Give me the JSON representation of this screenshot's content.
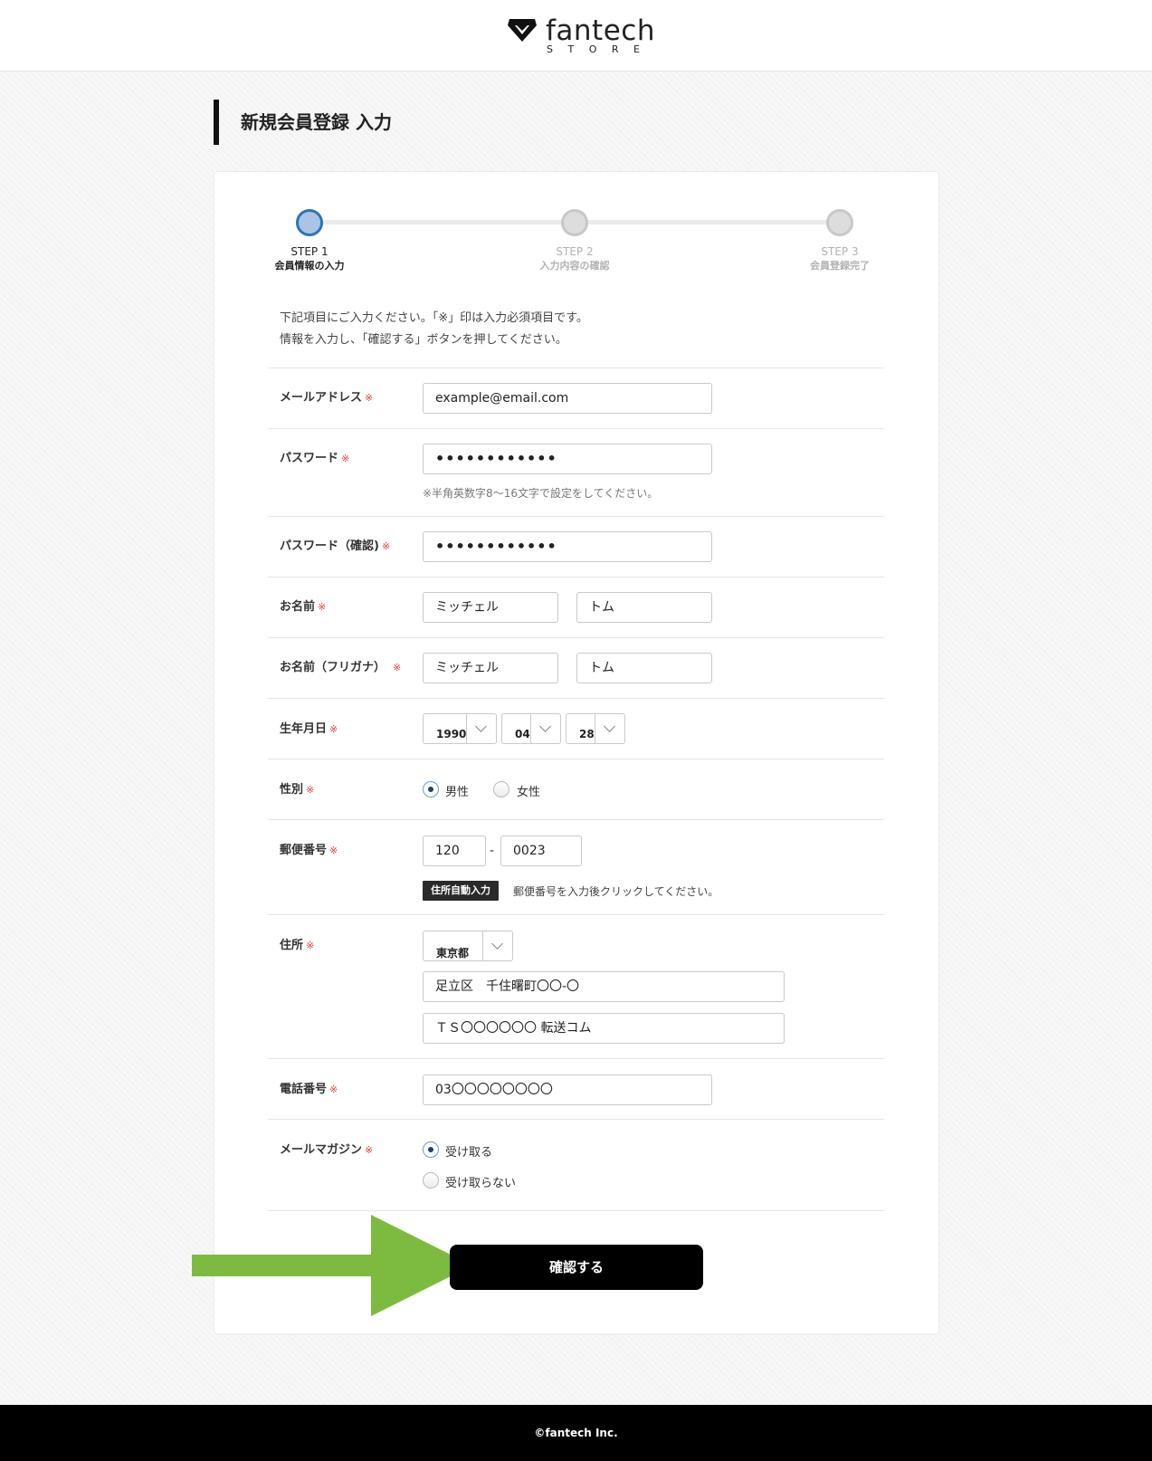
{
  "brand": {
    "name": "fantech",
    "sub": "STORE"
  },
  "page_title": "新規会員登録 入力",
  "steps": [
    {
      "step": "STEP 1",
      "label": "会員情報の入力",
      "active": true
    },
    {
      "step": "STEP 2",
      "label": "入力内容の確認",
      "active": false
    },
    {
      "step": "STEP 3",
      "label": "会員登録完了",
      "active": false
    }
  ],
  "intro": [
    "下記項目にご入力ください。「※」印は入力必須項目です。",
    "情報を入力し、「確認する」ボタンを押してください。"
  ],
  "required_mark": "※",
  "fields": {
    "email": {
      "label": "メールアドレス",
      "value": "example@email.com"
    },
    "password": {
      "label": "パスワード",
      "value": "••••••••••••",
      "hint": "※半角英数字8〜16文字で設定をしてください。"
    },
    "password_confirm": {
      "label": "パスワード（確認)",
      "value": "••••••••••••"
    },
    "name": {
      "label": "お名前",
      "last": "ミッチェル",
      "first": "トム"
    },
    "name_kana": {
      "label": "お名前（フリガナ）",
      "last": "ミッチェル",
      "first": "トム"
    },
    "birthday": {
      "label": "生年月日",
      "year": "1990",
      "month": "04",
      "day": "28"
    },
    "gender": {
      "label": "性別",
      "options": [
        "男性",
        "女性"
      ],
      "selected": "男性"
    },
    "postal": {
      "label": "郵便番号",
      "first": "120",
      "sep": "-",
      "second": "0023",
      "auto_button": "住所自動入力",
      "auto_hint": "郵便番号を入力後クリックしてください。"
    },
    "address": {
      "label": "住所",
      "prefecture": "東京都",
      "line1": "足立区　千住曙町〇〇-〇",
      "line2": "ＴＳ〇〇〇〇〇〇 転送コム"
    },
    "phone": {
      "label": "電話番号",
      "value": "03〇〇〇〇〇〇〇〇"
    },
    "newsletter": {
      "label": "メールマガジン",
      "options": [
        "受け取る",
        "受け取らない"
      ],
      "selected": "受け取る"
    }
  },
  "submit_label": "確認する",
  "footer": "©fantech Inc.",
  "colors": {
    "accent": "#2f73b8",
    "required": "#e03b3b",
    "arrow": "#7cbb3f"
  }
}
